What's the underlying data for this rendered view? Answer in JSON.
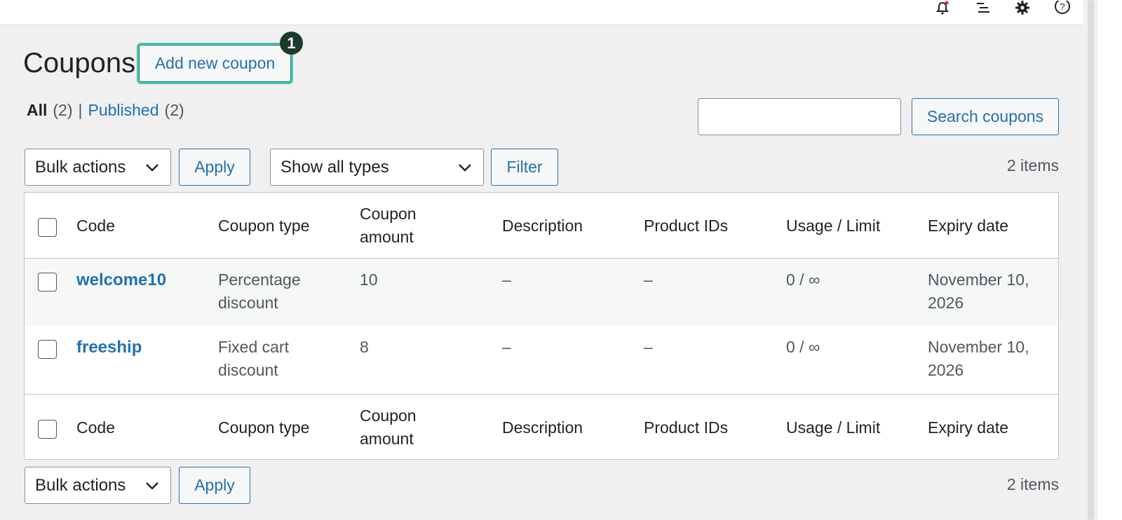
{
  "page": {
    "title": "Coupons",
    "add_new_label": "Add new coupon",
    "badge": "1"
  },
  "filters": {
    "all_label": "All",
    "all_count": "(2)",
    "separator": "|",
    "published_label": "Published",
    "published_count": "(2)"
  },
  "search": {
    "button_label": "Search coupons",
    "value": ""
  },
  "toolbar": {
    "bulk_actions": "Bulk actions",
    "apply_label": "Apply",
    "types_select": "Show all types",
    "filter_label": "Filter",
    "items_count": "2 items"
  },
  "table": {
    "headers": [
      "Code",
      "Coupon type",
      "Coupon amount",
      "Description",
      "Product IDs",
      "Usage / Limit",
      "Expiry date"
    ],
    "rows": [
      {
        "code": "welcome10",
        "type": "Percentage discount",
        "amount": "10",
        "description": "–",
        "product_ids": "–",
        "usage": "0 / ∞",
        "expiry": "November 10, 2026"
      },
      {
        "code": "freeship",
        "type": "Fixed cart discount",
        "amount": "8",
        "description": "–",
        "product_ids": "–",
        "usage": "0 / ∞",
        "expiry": "November 10, 2026"
      }
    ]
  },
  "icons": [
    "notification-bell-icon",
    "activity-list-icon",
    "settings-gear-icon",
    "help-icon"
  ],
  "colors": {
    "accent": "#2271b1",
    "focus_ring": "#49c8a0",
    "badge_bg": "#1c3b2f"
  }
}
